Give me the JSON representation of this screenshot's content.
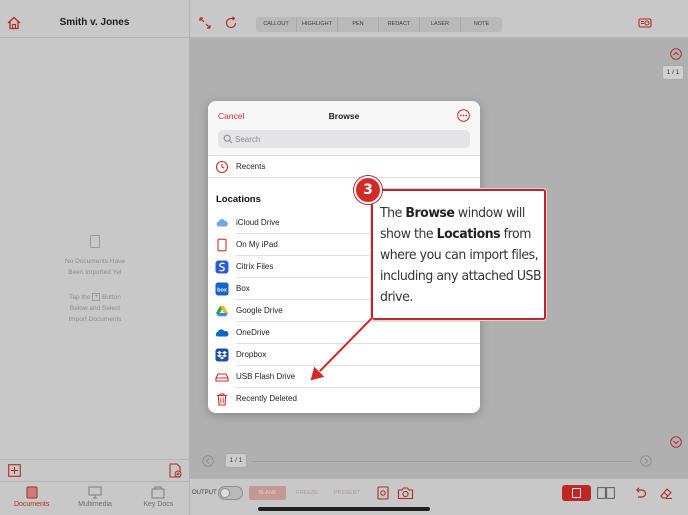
{
  "sidebar": {
    "title": "Smith v. Jones",
    "empty_line1": "No Documents Have",
    "empty_line2": "Been Imported Yet",
    "hint_line1a": "Tap the",
    "hint_line1b": "Button",
    "hint_line2": "Below and Select",
    "hint_line3": "Import Documents",
    "hint_plus": "+",
    "tabs": [
      {
        "label": "Documents",
        "active": true
      },
      {
        "label": "Multimedia",
        "active": false
      },
      {
        "label": "Key Docs",
        "active": false
      }
    ]
  },
  "toolbar": {
    "tools": [
      "CALLOUT",
      "HIGHLIGHT",
      "PEN",
      "REDACT",
      "LASER",
      "NOTE"
    ]
  },
  "canvas": {
    "page_indicator": "1 / 1",
    "pager_label": "1 / 1"
  },
  "bottombar": {
    "output_label": "OUTPUT",
    "blank_label": "BLANK",
    "freeze_label": "FREEZE",
    "present_label": "PRESENT"
  },
  "browse": {
    "cancel_label": "Cancel",
    "title": "Browse",
    "search_placeholder": "Search",
    "recents_label": "Recents",
    "locations_heading": "Locations",
    "locations": [
      {
        "label": "iCloud Drive",
        "icon": "cloud-icon"
      },
      {
        "label": "On My iPad",
        "icon": "ipad-icon"
      },
      {
        "label": "Citrix Files",
        "icon": "citrix-icon"
      },
      {
        "label": "Box",
        "icon": "box-icon"
      },
      {
        "label": "Google Drive",
        "icon": "google-drive-icon"
      },
      {
        "label": "OneDrive",
        "icon": "onedrive-icon"
      },
      {
        "label": "Dropbox",
        "icon": "dropbox-icon"
      },
      {
        "label": "USB Flash Drive",
        "icon": "usb-drive-icon"
      },
      {
        "label": "Recently Deleted",
        "icon": "trash-icon"
      }
    ]
  },
  "callout": {
    "step_number": "3",
    "t1": "The ",
    "b1": "Browse",
    "t2": " window will show the ",
    "b2": "Locations",
    "t3": " from where you can import files, including any attached USB drive."
  },
  "colors": {
    "accent": "#d22b25",
    "callout_border": "#b8292f"
  }
}
